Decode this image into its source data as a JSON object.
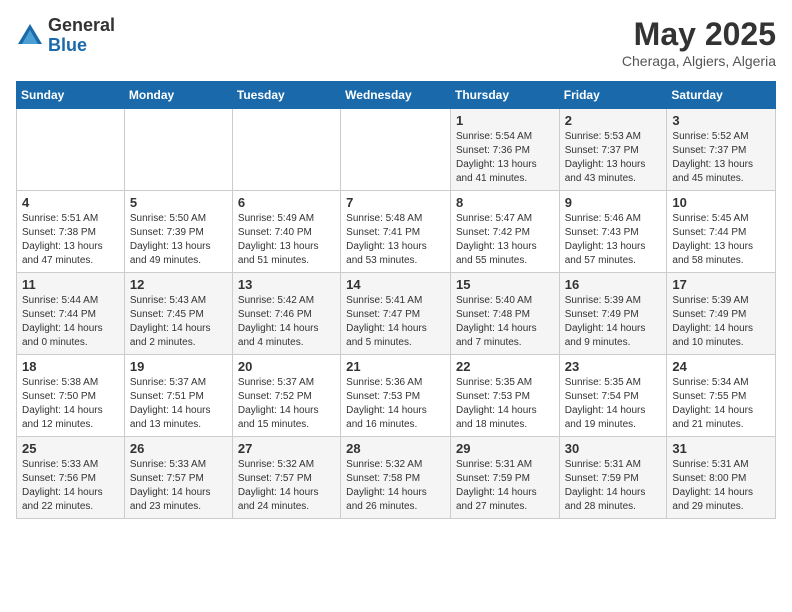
{
  "logo": {
    "general": "General",
    "blue": "Blue"
  },
  "title": "May 2025",
  "location": "Cheraga, Algiers, Algeria",
  "days_of_week": [
    "Sunday",
    "Monday",
    "Tuesday",
    "Wednesday",
    "Thursday",
    "Friday",
    "Saturday"
  ],
  "weeks": [
    [
      {
        "day": "",
        "info": ""
      },
      {
        "day": "",
        "info": ""
      },
      {
        "day": "",
        "info": ""
      },
      {
        "day": "",
        "info": ""
      },
      {
        "day": "1",
        "info": "Sunrise: 5:54 AM\nSunset: 7:36 PM\nDaylight: 13 hours\nand 41 minutes."
      },
      {
        "day": "2",
        "info": "Sunrise: 5:53 AM\nSunset: 7:37 PM\nDaylight: 13 hours\nand 43 minutes."
      },
      {
        "day": "3",
        "info": "Sunrise: 5:52 AM\nSunset: 7:37 PM\nDaylight: 13 hours\nand 45 minutes."
      }
    ],
    [
      {
        "day": "4",
        "info": "Sunrise: 5:51 AM\nSunset: 7:38 PM\nDaylight: 13 hours\nand 47 minutes."
      },
      {
        "day": "5",
        "info": "Sunrise: 5:50 AM\nSunset: 7:39 PM\nDaylight: 13 hours\nand 49 minutes."
      },
      {
        "day": "6",
        "info": "Sunrise: 5:49 AM\nSunset: 7:40 PM\nDaylight: 13 hours\nand 51 minutes."
      },
      {
        "day": "7",
        "info": "Sunrise: 5:48 AM\nSunset: 7:41 PM\nDaylight: 13 hours\nand 53 minutes."
      },
      {
        "day": "8",
        "info": "Sunrise: 5:47 AM\nSunset: 7:42 PM\nDaylight: 13 hours\nand 55 minutes."
      },
      {
        "day": "9",
        "info": "Sunrise: 5:46 AM\nSunset: 7:43 PM\nDaylight: 13 hours\nand 57 minutes."
      },
      {
        "day": "10",
        "info": "Sunrise: 5:45 AM\nSunset: 7:44 PM\nDaylight: 13 hours\nand 58 minutes."
      }
    ],
    [
      {
        "day": "11",
        "info": "Sunrise: 5:44 AM\nSunset: 7:44 PM\nDaylight: 14 hours\nand 0 minutes."
      },
      {
        "day": "12",
        "info": "Sunrise: 5:43 AM\nSunset: 7:45 PM\nDaylight: 14 hours\nand 2 minutes."
      },
      {
        "day": "13",
        "info": "Sunrise: 5:42 AM\nSunset: 7:46 PM\nDaylight: 14 hours\nand 4 minutes."
      },
      {
        "day": "14",
        "info": "Sunrise: 5:41 AM\nSunset: 7:47 PM\nDaylight: 14 hours\nand 5 minutes."
      },
      {
        "day": "15",
        "info": "Sunrise: 5:40 AM\nSunset: 7:48 PM\nDaylight: 14 hours\nand 7 minutes."
      },
      {
        "day": "16",
        "info": "Sunrise: 5:39 AM\nSunset: 7:49 PM\nDaylight: 14 hours\nand 9 minutes."
      },
      {
        "day": "17",
        "info": "Sunrise: 5:39 AM\nSunset: 7:49 PM\nDaylight: 14 hours\nand 10 minutes."
      }
    ],
    [
      {
        "day": "18",
        "info": "Sunrise: 5:38 AM\nSunset: 7:50 PM\nDaylight: 14 hours\nand 12 minutes."
      },
      {
        "day": "19",
        "info": "Sunrise: 5:37 AM\nSunset: 7:51 PM\nDaylight: 14 hours\nand 13 minutes."
      },
      {
        "day": "20",
        "info": "Sunrise: 5:37 AM\nSunset: 7:52 PM\nDaylight: 14 hours\nand 15 minutes."
      },
      {
        "day": "21",
        "info": "Sunrise: 5:36 AM\nSunset: 7:53 PM\nDaylight: 14 hours\nand 16 minutes."
      },
      {
        "day": "22",
        "info": "Sunrise: 5:35 AM\nSunset: 7:53 PM\nDaylight: 14 hours\nand 18 minutes."
      },
      {
        "day": "23",
        "info": "Sunrise: 5:35 AM\nSunset: 7:54 PM\nDaylight: 14 hours\nand 19 minutes."
      },
      {
        "day": "24",
        "info": "Sunrise: 5:34 AM\nSunset: 7:55 PM\nDaylight: 14 hours\nand 21 minutes."
      }
    ],
    [
      {
        "day": "25",
        "info": "Sunrise: 5:33 AM\nSunset: 7:56 PM\nDaylight: 14 hours\nand 22 minutes."
      },
      {
        "day": "26",
        "info": "Sunrise: 5:33 AM\nSunset: 7:57 PM\nDaylight: 14 hours\nand 23 minutes."
      },
      {
        "day": "27",
        "info": "Sunrise: 5:32 AM\nSunset: 7:57 PM\nDaylight: 14 hours\nand 24 minutes."
      },
      {
        "day": "28",
        "info": "Sunrise: 5:32 AM\nSunset: 7:58 PM\nDaylight: 14 hours\nand 26 minutes."
      },
      {
        "day": "29",
        "info": "Sunrise: 5:31 AM\nSunset: 7:59 PM\nDaylight: 14 hours\nand 27 minutes."
      },
      {
        "day": "30",
        "info": "Sunrise: 5:31 AM\nSunset: 7:59 PM\nDaylight: 14 hours\nand 28 minutes."
      },
      {
        "day": "31",
        "info": "Sunrise: 5:31 AM\nSunset: 8:00 PM\nDaylight: 14 hours\nand 29 minutes."
      }
    ]
  ]
}
